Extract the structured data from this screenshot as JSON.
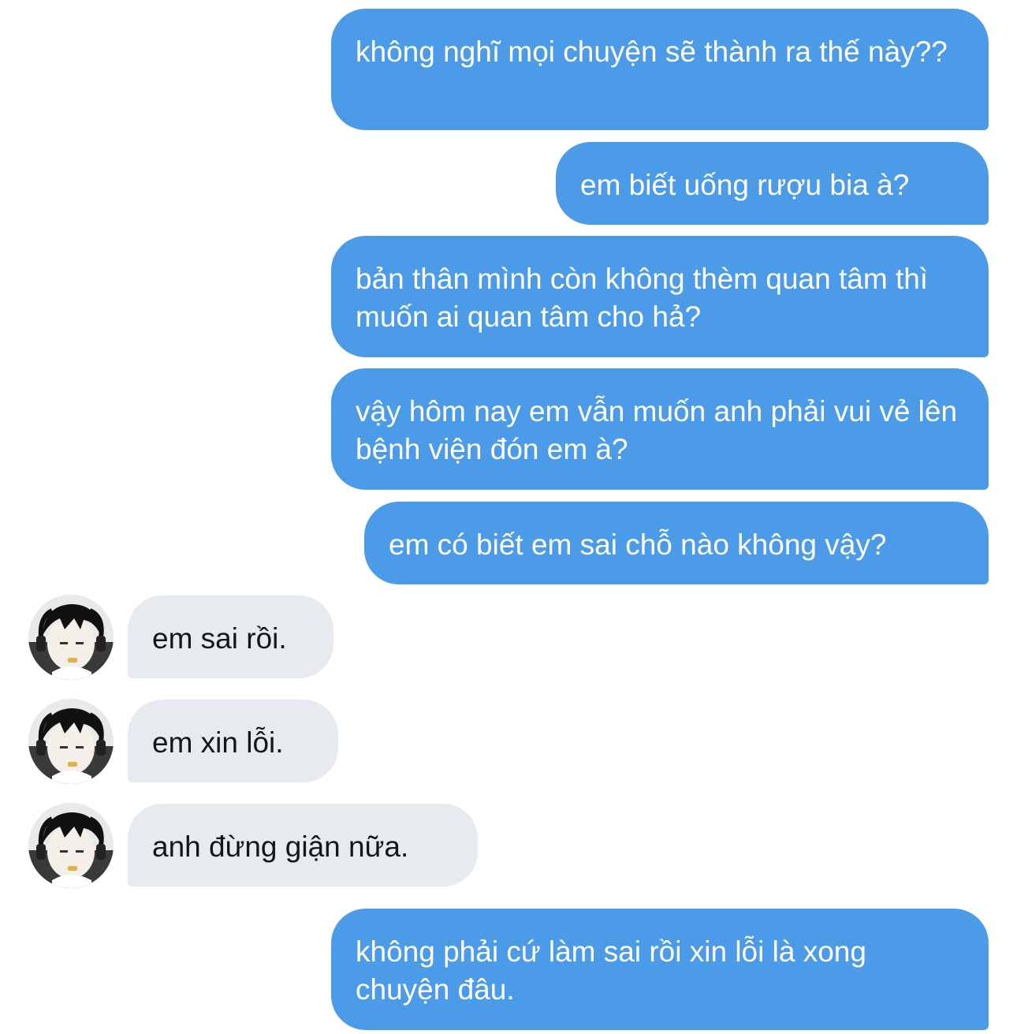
{
  "conversation": {
    "messages": [
      {
        "sender": "me",
        "text": "không nghĩ mọi chuyện sẽ thành ra thế này??"
      },
      {
        "sender": "me",
        "text": "em biết uống rượu bia à?"
      },
      {
        "sender": "me",
        "text": "bản thân mình còn không thèm quan tâm thì muốn ai quan tâm cho hả?"
      },
      {
        "sender": "me",
        "text": "vậy hôm nay em vẫn muốn anh phải vui vẻ lên bệnh viện đón em à?"
      },
      {
        "sender": "me",
        "text": "em có biết em sai chỗ nào không vậy?"
      },
      {
        "sender": "them",
        "text": "em sai rồi."
      },
      {
        "sender": "them",
        "text": "em xin lỗi."
      },
      {
        "sender": "them",
        "text": "anh đừng giận nữa."
      },
      {
        "sender": "me",
        "text": "không phải cứ làm sai rồi xin lỗi là xong chuyện đâu."
      }
    ]
  },
  "colors": {
    "sent_bubble": "#4c9be8",
    "received_bubble": "#e7eaee",
    "sent_text": "#ffffff",
    "received_text": "#14171a"
  },
  "icons": {
    "avatar": "contact-avatar-photo"
  }
}
